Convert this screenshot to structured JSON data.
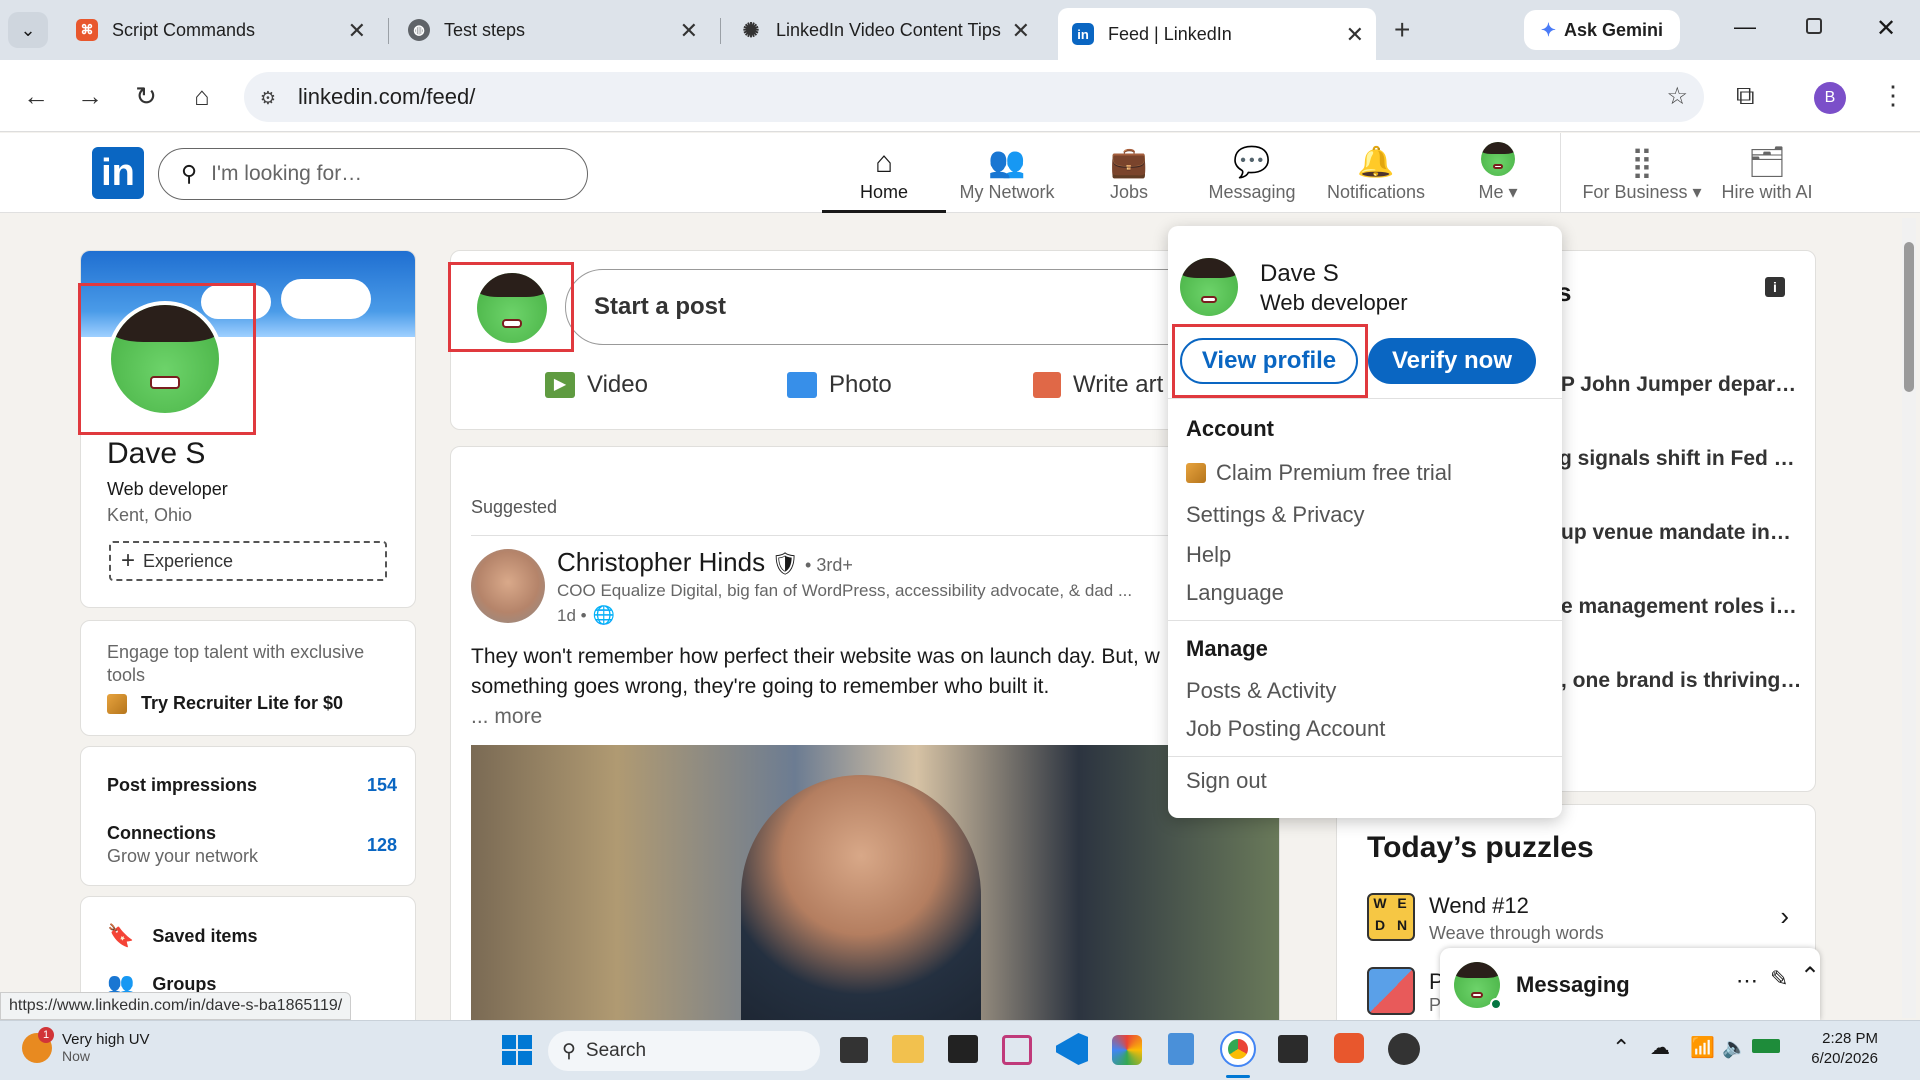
{
  "browser": {
    "tabs": [
      {
        "title": "Script Commands",
        "icon": "scriptcase-icon",
        "color": "#e8572d"
      },
      {
        "title": "Test steps",
        "icon": "globe-icon",
        "color": "#5f6368"
      },
      {
        "title": "LinkedIn Video Content Tips",
        "icon": "chatgpt-icon",
        "color": "#333333"
      },
      {
        "title": "Feed | LinkedIn",
        "icon": "linkedin-icon",
        "color": "#0a66c2"
      }
    ],
    "gemini_label": "Ask Gemini",
    "url": "linkedin.com/feed/",
    "profile_initial": "B",
    "status_url": "https://www.linkedin.com/in/dave-s-ba1865119/"
  },
  "linkedin": {
    "logo": "in",
    "search_placeholder": "I'm looking for…",
    "nav": [
      {
        "label": "Home",
        "icon": "home-icon",
        "active": true
      },
      {
        "label": "My Network",
        "icon": "network-icon"
      },
      {
        "label": "Jobs",
        "icon": "briefcase-icon"
      },
      {
        "label": "Messaging",
        "icon": "messaging-icon"
      },
      {
        "label": "Notifications",
        "icon": "bell-icon"
      },
      {
        "label": "Me",
        "icon": "avatar"
      },
      {
        "label": "For Business",
        "icon": "grid-icon"
      },
      {
        "label": "Hire with AI",
        "icon": "hire-icon"
      }
    ],
    "profile_card": {
      "name": "Dave S",
      "headline": "Web developer",
      "location": "Kent, Ohio",
      "experience_btn": "Experience"
    },
    "recruiter_card": {
      "text": "Engage top talent with exclusive tools",
      "cta": "Try Recruiter Lite for $0"
    },
    "stats": [
      {
        "label": "Post impressions",
        "sub": "",
        "value": "154"
      },
      {
        "label": "Connections",
        "sub": "Grow your network",
        "value": "128"
      }
    ],
    "shortcuts": [
      "Saved items",
      "Groups"
    ],
    "composer": {
      "placeholder": "Start a post",
      "actions": [
        "Video",
        "Photo",
        "Write art"
      ]
    },
    "post": {
      "suggested": "Suggested",
      "author": "Christopher Hinds",
      "degree": "• 3rd+",
      "author_headline": "COO Equalize Digital, big fan of WordPress, accessibility advocate, & dad ...",
      "time": "1d •",
      "text1": "They won't remember how perfect their website was on launch day. But, w",
      "text2": "something goes wrong, they're going to remember who built it.",
      "more": "... more"
    },
    "news": {
      "title": "s",
      "items": [
        "/P John Jumper depar…",
        "g signals shift in Fed …",
        "up venue mandate in…",
        "e management roles i…",
        ", one brand is thriving…"
      ]
    },
    "puzzles": {
      "title": "Today’s puzzles",
      "items": [
        {
          "name": "Wend #12",
          "desc": "Weave through words"
        },
        {
          "name": "P",
          "desc": "P"
        }
      ]
    },
    "me_menu": {
      "name": "Dave S",
      "headline": "Web developer",
      "view_profile": "View profile",
      "verify": "Verify now",
      "account_head": "Account",
      "account_items": [
        "Claim Premium free trial",
        "Settings & Privacy",
        "Help",
        "Language"
      ],
      "manage_head": "Manage",
      "manage_items": [
        "Posts & Activity",
        "Job Posting Account"
      ],
      "sign_out": "Sign out"
    },
    "messaging": {
      "label": "Messaging"
    }
  },
  "taskbar": {
    "weather_title": "Very high UV",
    "weather_sub": "Now",
    "weather_badge": "1",
    "search": "Search",
    "time": "2:28 PM",
    "date": "6/20/2026"
  }
}
